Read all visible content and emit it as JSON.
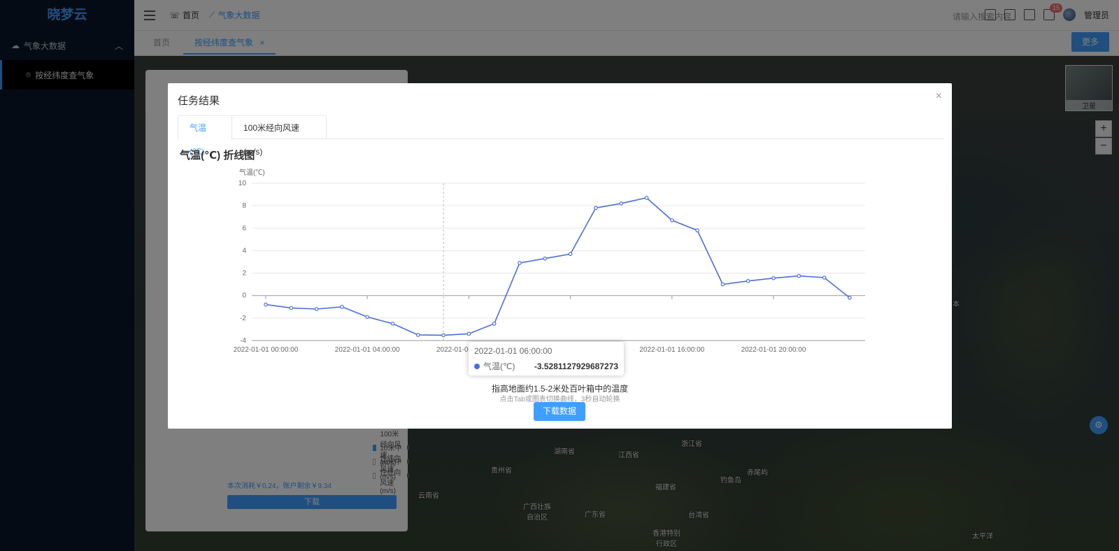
{
  "app": {
    "logo": "晓梦云"
  },
  "sidebar": {
    "group": "气象大数据",
    "item": "按经纬度查气象"
  },
  "topbar": {
    "breadcrumb_home": "首页",
    "breadcrumb_current": "气象大数据",
    "search_placeholder": "请输入搜索内容",
    "notification_count": "15",
    "user": "管理员"
  },
  "tabs": {
    "home": "首页",
    "current": "按经纬度查气象",
    "close": "×",
    "more": "更多"
  },
  "map": {
    "layer_label": "卫星",
    "zoom_in": "+",
    "zoom_out": "−",
    "labels": [
      "贵州省",
      "湖南省",
      "江西省",
      "浙江省",
      "福建省",
      "广东省",
      "云南省",
      "广西壮族自治区",
      "台湾省",
      "香港特别行政区",
      "钓鱼岛",
      "赤尾屿",
      "太平洋",
      "日本"
    ]
  },
  "panel": {
    "options": [
      {
        "label": "100米经向风速(m/s)",
        "checked": true
      },
      {
        "label": "10米中性纬向风速(m/s)",
        "checked": false
      },
      {
        "label": "10米中性经向风速(m/s)",
        "checked": false
      }
    ],
    "cost": "本次消耗￥0.24，账户剩余￥9.34",
    "download": "下载"
  },
  "dialog": {
    "title": "任务结果",
    "close": "×",
    "tabs": [
      "气温(℃)",
      "100米经向风速(m/s)"
    ],
    "chart_title": "气温(℃) 折线图",
    "description": "指高地面约1.5-2米处百叶箱中的温度",
    "hint": "点击Tab或图表切换曲线，3秒自动轮换",
    "download_button": "下载数据",
    "tooltip": {
      "time": "2022-01-01 06:00:00",
      "series": "气温(℃)",
      "value": "-3.5281127929687273"
    }
  },
  "chart_data": {
    "type": "line",
    "title": "气温(℃) 折线图",
    "ylabel": "气温(℃)",
    "ylim": [
      -4,
      10
    ],
    "yticks": [
      -4,
      -2,
      0,
      2,
      4,
      6,
      8,
      10
    ],
    "xtick_labels": [
      "2022-01-01 00:00:00",
      "2022-01-01 04:00:00",
      "2022-01-01 08:00:00",
      "2022-01-01 12:00:00",
      "2022-01-01 16:00:00",
      "2022-01-01 20:00:00"
    ],
    "xtick_hours": [
      0,
      4,
      8,
      12,
      16,
      20
    ],
    "x_hours": [
      0,
      1,
      2,
      3,
      4,
      5,
      6,
      7,
      8,
      9,
      10,
      11,
      12,
      13,
      14,
      15,
      16,
      17,
      18,
      19,
      20,
      21,
      22,
      23
    ],
    "series": [
      {
        "name": "气温(℃)",
        "color": "#4b6fd6",
        "values": [
          -0.8,
          -1.1,
          -1.2,
          -1.0,
          -1.9,
          -2.5,
          -3.5,
          -3.53,
          -3.4,
          -2.5,
          2.9,
          3.3,
          3.7,
          7.8,
          8.2,
          8.7,
          6.7,
          5.8,
          1.0,
          1.3,
          1.55,
          1.75,
          1.6,
          -0.2
        ]
      }
    ],
    "hover_hour": 7
  }
}
